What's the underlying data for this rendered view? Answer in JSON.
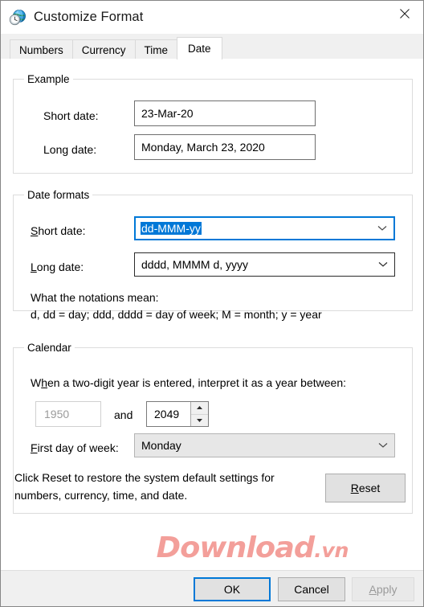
{
  "window": {
    "title": "Customize Format",
    "icon": "region-globe-clock-icon",
    "close_label": "✕"
  },
  "tabs": [
    {
      "label": "Numbers",
      "active": false
    },
    {
      "label": "Currency",
      "active": false
    },
    {
      "label": "Time",
      "active": false
    },
    {
      "label": "Date",
      "active": true
    }
  ],
  "example_group": {
    "legend": "Example",
    "short_date_label": "Short date:",
    "short_date_value": "23-Mar-20",
    "long_date_label": "Long date:",
    "long_date_value": "Monday, March 23, 2020"
  },
  "formats_group": {
    "legend": "Date formats",
    "short_date_label_pre": "S",
    "short_date_label_post": "hort date:",
    "short_date_value": "dd-MMM-yy",
    "short_date_selected": true,
    "long_date_label_pre": "L",
    "long_date_label_post": "ong date:",
    "long_date_value": "dddd, MMMM d, yyyy",
    "notations_title": "What the notations mean:",
    "notations_body": "d, dd = day;  ddd, dddd = day of week;  M = month;  y = year"
  },
  "calendar_group": {
    "legend": "Calendar",
    "sentence_pre": "W",
    "sentence_accel": "h",
    "sentence_post": "en a two-digit year is entered, interpret it as a year between:",
    "year_from_value": "1950",
    "and_label": "and",
    "year_to_value": "2049",
    "first_day_label_pre": "F",
    "first_day_label_post": "irst day of week:",
    "first_day_value": "Monday"
  },
  "reset_section": {
    "description_line1": "Click Reset to restore the system default settings for",
    "description_line2": "numbers, currency, time, and date.",
    "button_label_pre": "R",
    "button_label_post": "eset"
  },
  "footer": {
    "ok_label": "OK",
    "cancel_label": "Cancel",
    "apply_label_pre": "A",
    "apply_label_post": "pply",
    "apply_disabled": true
  },
  "watermark": {
    "text": "Download",
    "suffix": ".vn",
    "color": "#e8392e"
  },
  "colors": {
    "accent": "#0078d7",
    "footer_bg": "#f0f0f0",
    "group_border": "#dcdcdc",
    "disabled_text": "#9a9a9a"
  }
}
